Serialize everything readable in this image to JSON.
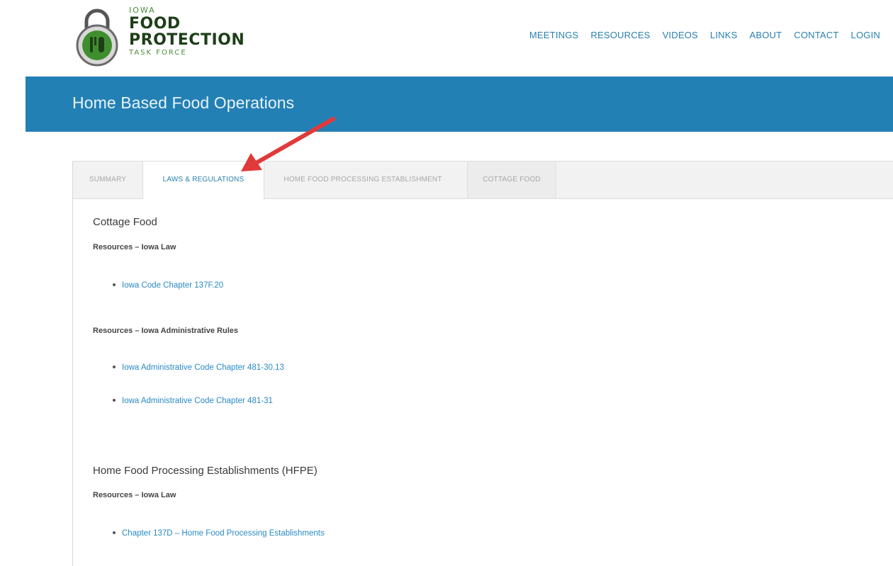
{
  "logo": {
    "line1": "IOWA",
    "line2": "FOOD",
    "line3": "PROTECTION",
    "line4": "TASK FORCE"
  },
  "nav": {
    "items": [
      {
        "label": "MEETINGS"
      },
      {
        "label": "RESOURCES"
      },
      {
        "label": "VIDEOS"
      },
      {
        "label": "LINKS"
      },
      {
        "label": "ABOUT"
      },
      {
        "label": "CONTACT"
      },
      {
        "label": "LOGIN"
      }
    ]
  },
  "banner": {
    "title": "Home Based Food Operations"
  },
  "tabs": [
    {
      "label": "SUMMARY"
    },
    {
      "label": "LAWS & REGULATIONS"
    },
    {
      "label": "HOME FOOD PROCESSING ESTABLISHMENT"
    },
    {
      "label": "COTTAGE FOOD"
    }
  ],
  "content": {
    "cottage": {
      "title": "Cottage Food",
      "law_heading": "Resources – Iowa Law",
      "law_links": [
        "Iowa Code Chapter 137F.20"
      ],
      "rules_heading": "Resources – Iowa Administrative Rules",
      "rules_links": [
        "Iowa Administrative Code Chapter 481-30.13",
        "Iowa Administrative Code Chapter 481-31"
      ]
    },
    "hfpe": {
      "title": "Home Food Processing Establishments (HFPE)",
      "law_heading": "Resources – Iowa Law",
      "law_links": [
        "Chapter 137D – Home Food Processing Establishments"
      ]
    }
  },
  "colors": {
    "banner": "#2380b5",
    "link": "#2a8ac4",
    "nav": "#2a7fb0",
    "arrow": "#e03a3a",
    "logo_dark": "#1e3e18",
    "logo_green": "#4a8a3a"
  }
}
